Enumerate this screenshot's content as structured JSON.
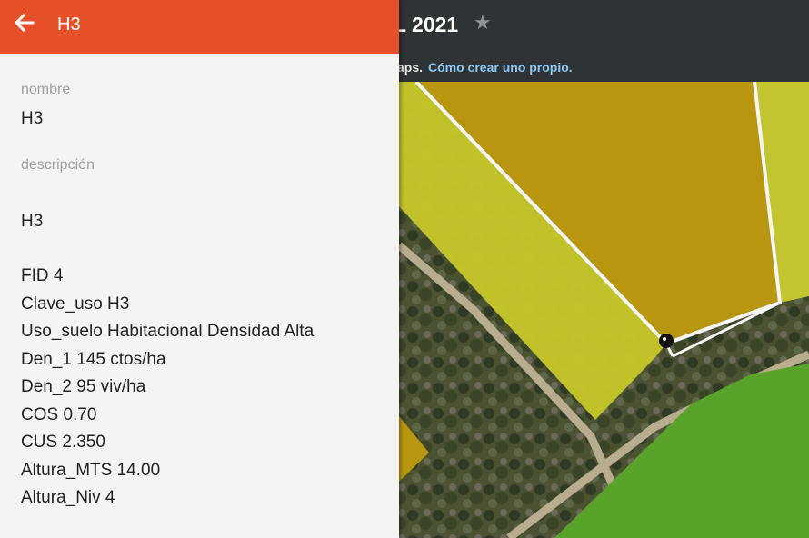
{
  "header": {
    "title": "H3",
    "back_icon": "arrow-left-icon",
    "background_color": "#e5502a"
  },
  "map_header": {
    "title_fragment": "L 2021",
    "star_icon": "star-icon",
    "notice_prefix": "aps.",
    "notice_link": "Cómo crear uno propio."
  },
  "fields": {
    "nombre_label": "nombre",
    "nombre_value": "H3",
    "descripcion_label": "descripción",
    "descripcion_value": "H3"
  },
  "description_lines": [
    "FID 4",
    "Clave_uso H3",
    "Uso_suelo Habitacional Densidad Alta",
    "Den_1 145 ctos/ha",
    "Den_2 95 viv/ha",
    "COS 0.70",
    "CUS 2.350",
    "Altura_MTS 14.00",
    "Altura_Niv 4"
  ],
  "map_colors": {
    "dark_orange_polygon": "#b8960f",
    "yellow_polygon": "#c6c62a",
    "green_polygon": "#5aa32a"
  }
}
